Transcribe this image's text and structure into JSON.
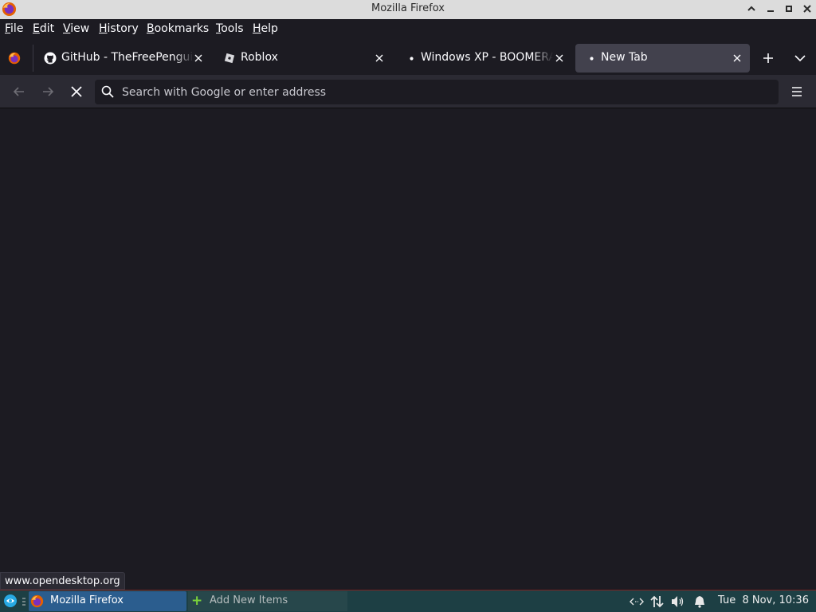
{
  "window": {
    "title": "Mozilla Firefox"
  },
  "menubar": {
    "items": [
      {
        "first": "F",
        "rest": "ile"
      },
      {
        "first": "E",
        "rest": "dit"
      },
      {
        "first": "V",
        "rest": "iew"
      },
      {
        "first": "H",
        "rest": "istory"
      },
      {
        "first": "B",
        "rest": "ookmarks"
      },
      {
        "first": "T",
        "rest": "ools"
      },
      {
        "first": "H",
        "rest": "elp"
      }
    ]
  },
  "tabs": [
    {
      "label": "GitHub - TheFreePenguin",
      "icon": "github-icon",
      "selected": false
    },
    {
      "label": "Roblox",
      "icon": "roblox-icon",
      "selected": false
    },
    {
      "label": "Windows XP - BOOMERANG",
      "icon": "dot-indicator",
      "selected": false
    },
    {
      "label": "New Tab",
      "icon": "dot-indicator",
      "selected": true
    }
  ],
  "urlbar": {
    "placeholder": "Search with Google or enter address"
  },
  "status": {
    "link": "www.opendesktop.org"
  },
  "taskbar": {
    "task_label": "Mozilla Firefox",
    "add_label": "Add New Items",
    "clock": "Tue  8 Nov, 10:36"
  },
  "colors": {
    "accent": "#2b5d8e",
    "selected_tab": "#42414d",
    "content_bg": "#1c1b22"
  }
}
